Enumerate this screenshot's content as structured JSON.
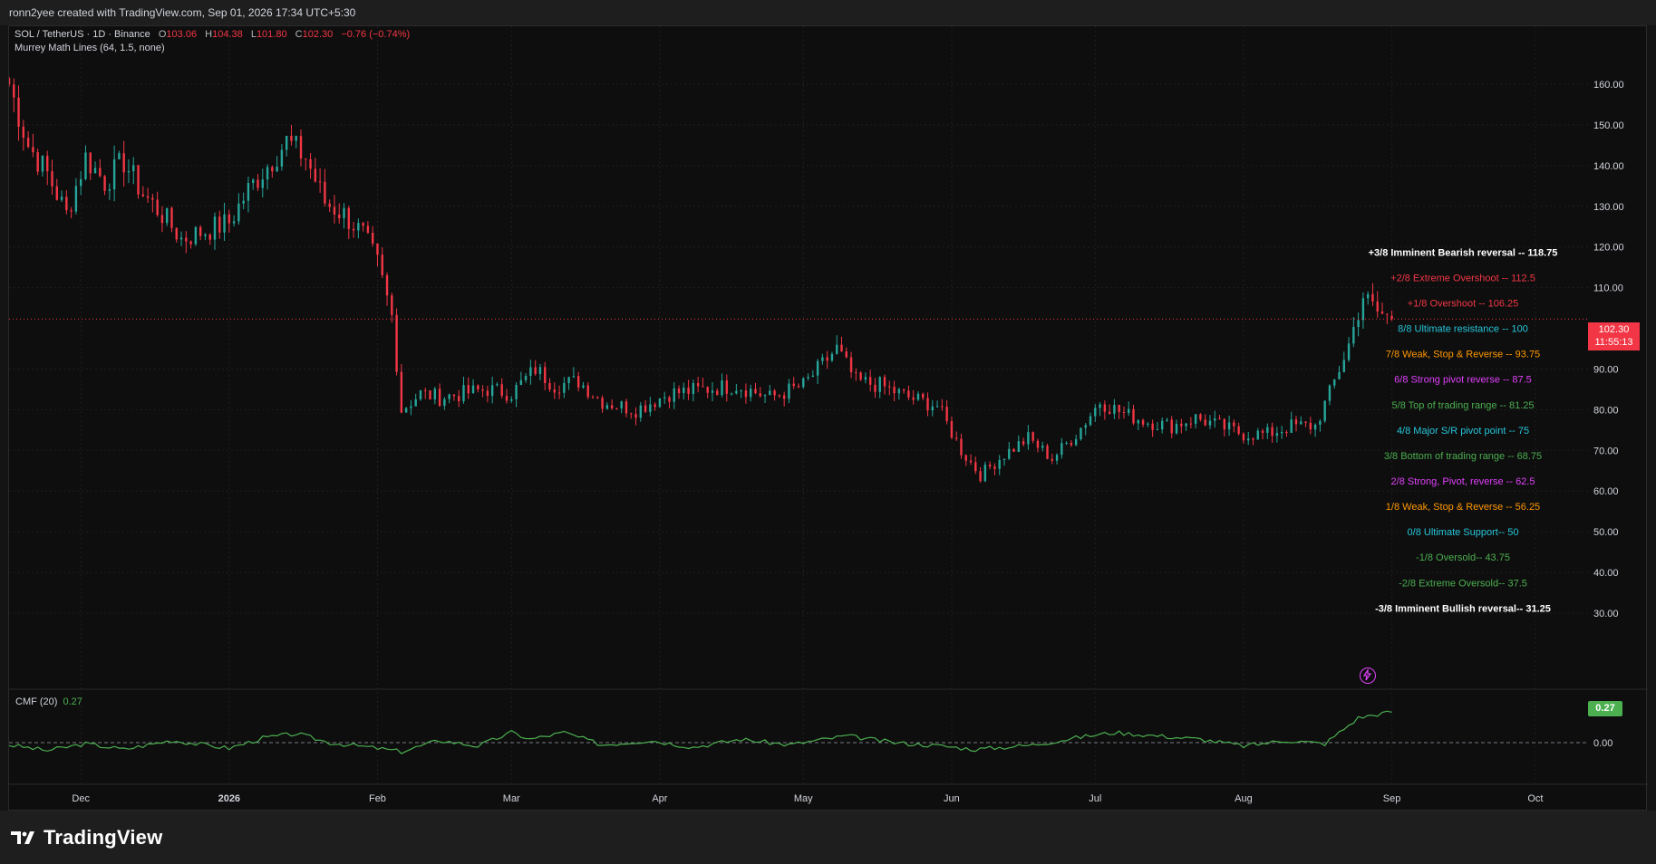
{
  "header": {
    "text": "ronn2yee created with TradingView.com, Sep 01, 2026 17:34 UTC+5:30"
  },
  "legend": {
    "symbol": "SOL / TetherUS · 1D · Binance",
    "o_label": "O",
    "o_value": "103.06",
    "h_label": "H",
    "h_value": "104.38",
    "l_label": "L",
    "l_value": "101.80",
    "c_label": "C",
    "c_value": "102.30",
    "change": "−0.76 (−0.74%)",
    "indicator": "Murrey Math Lines (64, 1.5, none)"
  },
  "price_axis": {
    "labels": [
      "160.00",
      "150.00",
      "140.00",
      "130.00",
      "120.00",
      "110.00",
      "90.00",
      "80.00",
      "70.00",
      "60.00",
      "50.00",
      "40.00",
      "30.00"
    ],
    "current_price": "102.30",
    "countdown": "11:55:13"
  },
  "time_axis": {
    "labels": [
      "Dec",
      "2026",
      "Feb",
      "Mar",
      "Apr",
      "May",
      "Jun",
      "Jul",
      "Aug",
      "Sep",
      "Oct"
    ]
  },
  "murrey_levels": [
    {
      "text": "+3/8 Imminent Bearish reversal --  118.75",
      "color": "#ffffff",
      "value": 118.75,
      "bold": true
    },
    {
      "text": "+2/8 Extreme Overshoot --  112.5",
      "color": "#f23645",
      "value": 112.5
    },
    {
      "text": "+1/8 Overshoot --  106.25",
      "color": "#f23645",
      "value": 106.25
    },
    {
      "text": "8/8 Ultimate resistance --  100",
      "color": "#26c6da",
      "value": 100
    },
    {
      "text": "7/8 Weak, Stop & Reverse --  93.75",
      "color": "#ff9800",
      "value": 93.75
    },
    {
      "text": "6/8 Strong pivot reverse --  87.5",
      "color": "#e040fb",
      "value": 87.5
    },
    {
      "text": "5/8 Top of trading range --  81.25",
      "color": "#4caf50",
      "value": 81.25
    },
    {
      "text": "4/8 Major S/R pivot point --  75",
      "color": "#26c6da",
      "value": 75
    },
    {
      "text": "3/8 Bottom of trading range --  68.75",
      "color": "#4caf50",
      "value": 68.75
    },
    {
      "text": "2/8 Strong, Pivot, reverse --  62.5",
      "color": "#e040fb",
      "value": 62.5
    },
    {
      "text": "1/8 Weak, Stop & Reverse --  56.25",
      "color": "#ff9800",
      "value": 56.25
    },
    {
      "text": "0/8 Ultimate Support--  50",
      "color": "#26c6da",
      "value": 50
    },
    {
      "text": "-1/8 Oversold--  43.75",
      "color": "#4caf50",
      "value": 43.75
    },
    {
      "text": "-2/8 Extreme Oversold--  37.5",
      "color": "#4caf50",
      "value": 37.5
    },
    {
      "text": "-3/8 Imminent Bullish reversal--  31.25",
      "color": "#ffffff",
      "value": 31.25,
      "bold": true
    }
  ],
  "cmf": {
    "label": "CMF (20)",
    "value": "0.27",
    "zero_label": "0.00"
  },
  "footer": {
    "brand": "TradingView"
  },
  "colors": {
    "up": "#26a69a",
    "down": "#f23645",
    "cmf": "#4caf50",
    "grid": "#1f1f1f",
    "background": "#0e0e0e"
  },
  "chart_data": {
    "type": "candlestick",
    "symbol": "SOL / TetherUS",
    "interval": "1D",
    "x_range": [
      "2025-11-16",
      "2026-10-12"
    ],
    "ylim": [
      25,
      165
    ],
    "close_path": [
      [
        "2025-11-16",
        160
      ],
      [
        "2025-11-20",
        145
      ],
      [
        "2025-11-24",
        138
      ],
      [
        "2025-11-28",
        128
      ],
      [
        "2025-12-02",
        142
      ],
      [
        "2025-12-06",
        136
      ],
      [
        "2025-12-10",
        141
      ],
      [
        "2025-12-14",
        133
      ],
      [
        "2025-12-18",
        128
      ],
      [
        "2025-12-22",
        122
      ],
      [
        "2025-12-27",
        124
      ],
      [
        "2026-01-01",
        126
      ],
      [
        "2026-01-05",
        134
      ],
      [
        "2026-01-09",
        140
      ],
      [
        "2026-01-13",
        146
      ],
      [
        "2026-01-17",
        142
      ],
      [
        "2026-01-21",
        131
      ],
      [
        "2026-01-25",
        128
      ],
      [
        "2026-01-29",
        123
      ],
      [
        "2026-02-01",
        116
      ],
      [
        "2026-02-04",
        103
      ],
      [
        "2026-02-06",
        80
      ],
      [
        "2026-02-10",
        84
      ],
      [
        "2026-02-14",
        83
      ],
      [
        "2026-02-19",
        84
      ],
      [
        "2026-02-24",
        85
      ],
      [
        "2026-03-01",
        84
      ],
      [
        "2026-03-06",
        90
      ],
      [
        "2026-03-10",
        86
      ],
      [
        "2026-03-15",
        87
      ],
      [
        "2026-03-20",
        82
      ],
      [
        "2026-03-27",
        80
      ],
      [
        "2026-04-03",
        84
      ],
      [
        "2026-04-10",
        85
      ],
      [
        "2026-04-17",
        86
      ],
      [
        "2026-04-24",
        83
      ],
      [
        "2026-05-01",
        86
      ],
      [
        "2026-05-08",
        95
      ],
      [
        "2026-05-12",
        87
      ],
      [
        "2026-05-17",
        86
      ],
      [
        "2026-05-23",
        83
      ],
      [
        "2026-05-29",
        81
      ],
      [
        "2026-06-03",
        70
      ],
      [
        "2026-06-07",
        64
      ],
      [
        "2026-06-12",
        69
      ],
      [
        "2026-06-17",
        73
      ],
      [
        "2026-06-22",
        68
      ],
      [
        "2026-06-27",
        74
      ],
      [
        "2026-07-02",
        82
      ],
      [
        "2026-07-07",
        79
      ],
      [
        "2026-07-12",
        77
      ],
      [
        "2026-07-17",
        76
      ],
      [
        "2026-07-22",
        78
      ],
      [
        "2026-07-27",
        76
      ],
      [
        "2026-08-01",
        74
      ],
      [
        "2026-08-06",
        74
      ],
      [
        "2026-08-11",
        76
      ],
      [
        "2026-08-16",
        76
      ],
      [
        "2026-08-19",
        84
      ],
      [
        "2026-08-23",
        96
      ],
      [
        "2026-08-26",
        108
      ],
      [
        "2026-08-29",
        104
      ],
      [
        "2026-09-01",
        102.3
      ]
    ],
    "cmf_ylim": [
      -0.45,
      0.45
    ],
    "cmf_path": [
      [
        "2025-11-16",
        -0.02
      ],
      [
        "2025-11-24",
        -0.07
      ],
      [
        "2025-12-02",
        -0.01
      ],
      [
        "2025-12-10",
        -0.06
      ],
      [
        "2025-12-20",
        0.02
      ],
      [
        "2026-01-01",
        -0.05
      ],
      [
        "2026-01-08",
        0.04
      ],
      [
        "2026-01-15",
        0.08
      ],
      [
        "2026-01-22",
        0.0
      ],
      [
        "2026-02-01",
        -0.05
      ],
      [
        "2026-02-06",
        -0.08
      ],
      [
        "2026-02-14",
        0.02
      ],
      [
        "2026-02-22",
        -0.03
      ],
      [
        "2026-03-01",
        0.09
      ],
      [
        "2026-03-05",
        0.03
      ],
      [
        "2026-03-12",
        0.09
      ],
      [
        "2026-03-20",
        -0.02
      ],
      [
        "2026-03-30",
        0.02
      ],
      [
        "2026-04-08",
        -0.04
      ],
      [
        "2026-04-18",
        0.03
      ],
      [
        "2026-04-28",
        -0.02
      ],
      [
        "2026-05-10",
        0.06
      ],
      [
        "2026-05-20",
        0.0
      ],
      [
        "2026-05-30",
        -0.03
      ],
      [
        "2026-06-06",
        -0.06
      ],
      [
        "2026-06-18",
        -0.02
      ],
      [
        "2026-06-28",
        0.05
      ],
      [
        "2026-07-05",
        0.09
      ],
      [
        "2026-07-14",
        0.06
      ],
      [
        "2026-07-23",
        0.03
      ],
      [
        "2026-08-01",
        -0.03
      ],
      [
        "2026-08-10",
        0.02
      ],
      [
        "2026-08-18",
        -0.01
      ],
      [
        "2026-08-25",
        0.22
      ],
      [
        "2026-08-30",
        0.26
      ],
      [
        "2026-09-01",
        0.27
      ]
    ]
  }
}
